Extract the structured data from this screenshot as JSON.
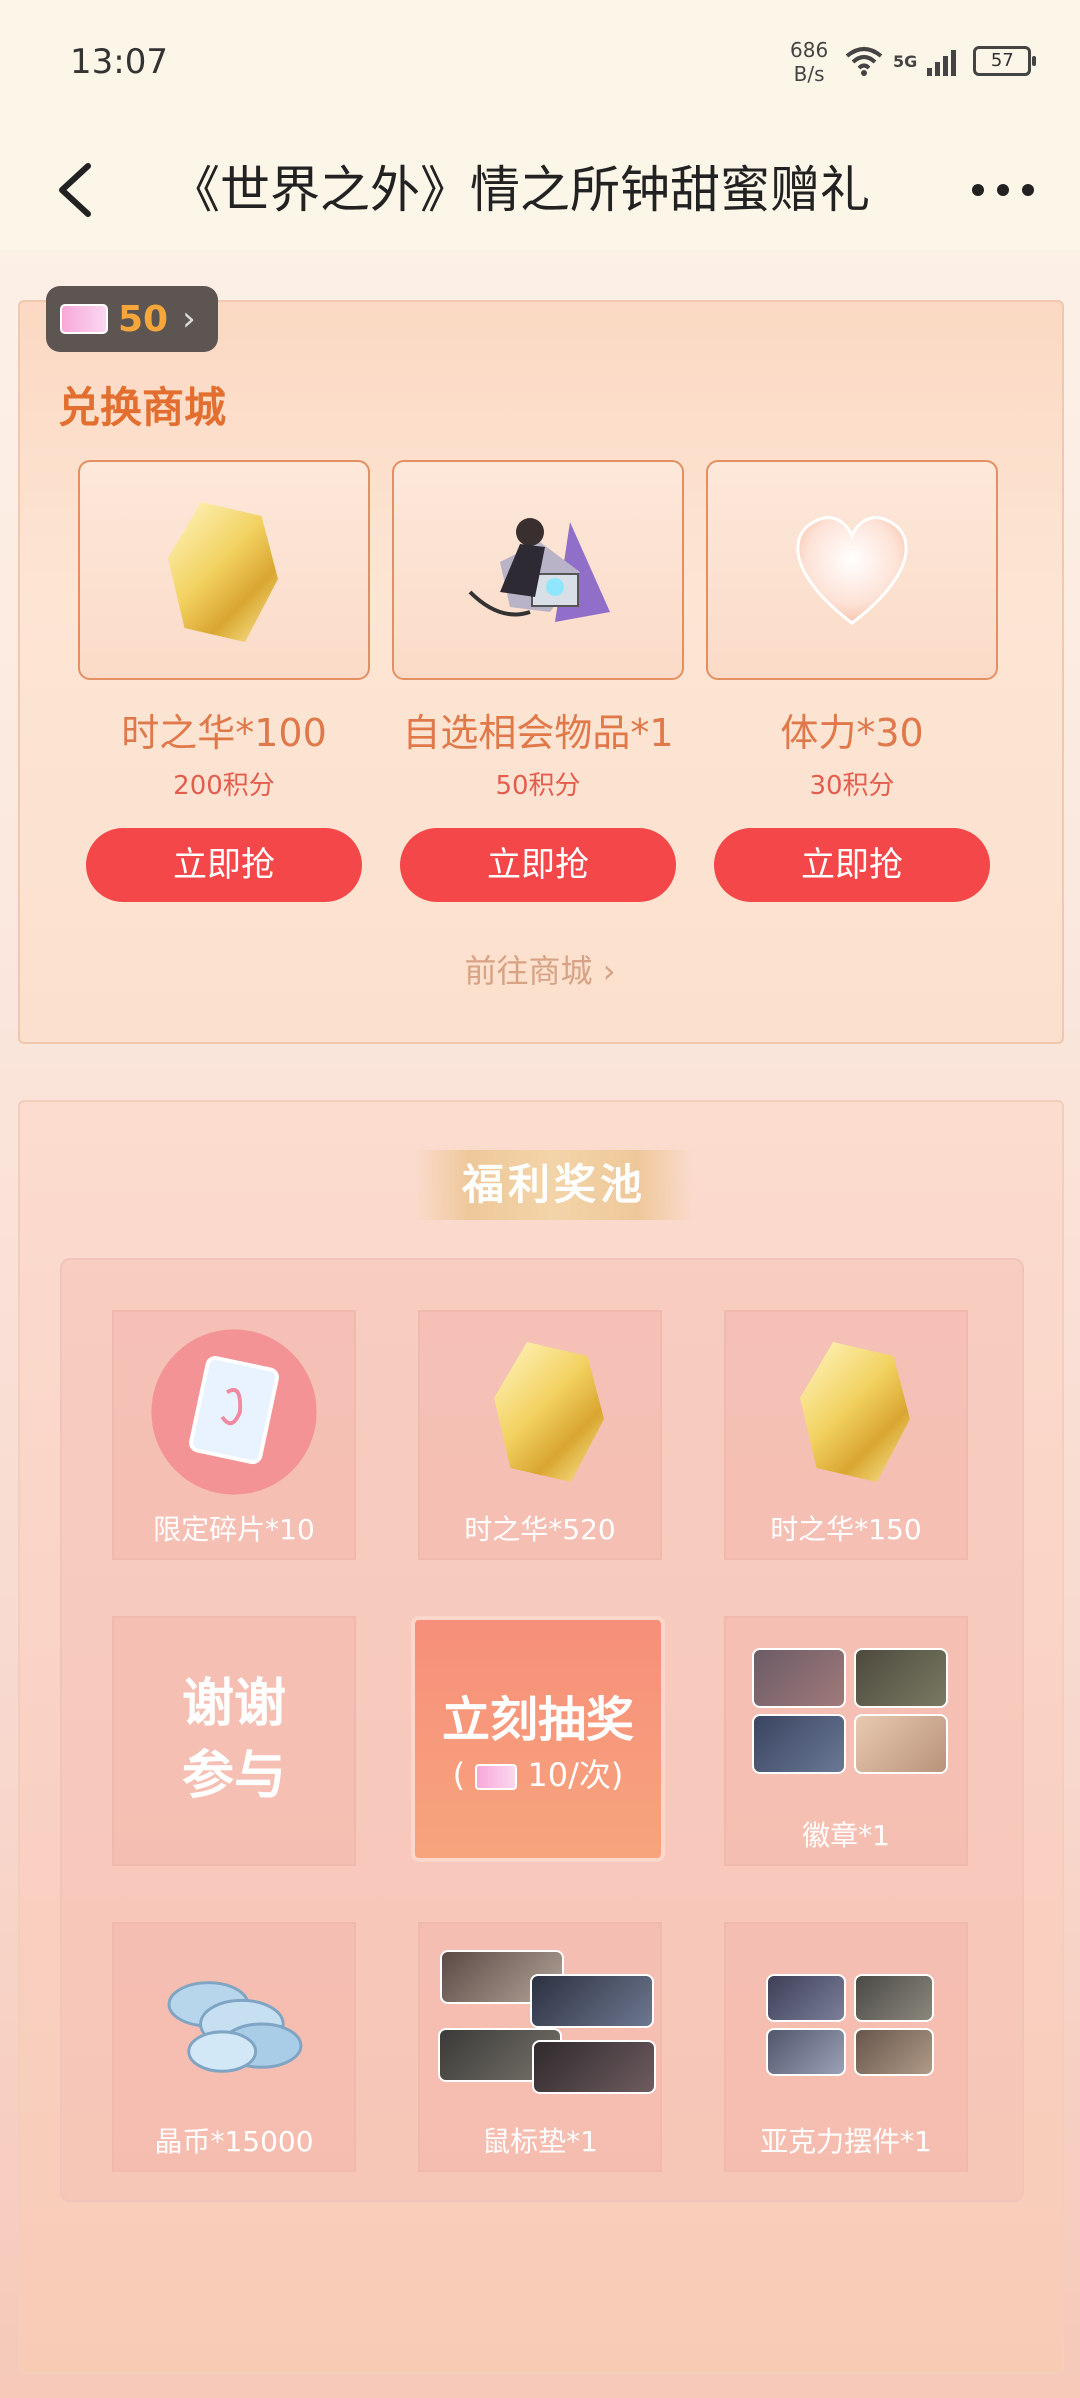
{
  "status_bar": {
    "time": "13:07",
    "net_speed_value": "686",
    "net_speed_unit": "B/s",
    "network": "5G",
    "battery": "57"
  },
  "header": {
    "title": "《世界之外》情之所钟甜蜜赠礼",
    "back_icon": "chevron-left-icon",
    "more_icon": "more-horizontal-icon"
  },
  "exchange": {
    "points": "50",
    "title": "兑换商城",
    "items": [
      {
        "name": "时之华*100",
        "price": "200积分",
        "button": "立即抢",
        "icon": "gold-crystal"
      },
      {
        "name": "自选相会物品*1",
        "price": "50积分",
        "button": "立即抢",
        "icon": "character-figure"
      },
      {
        "name": "体力*30",
        "price": "30积分",
        "button": "立即抢",
        "icon": "heart"
      }
    ],
    "goto_shop": "前往商城"
  },
  "pool": {
    "title": "福利奖池",
    "cells": [
      {
        "label": "限定碎片*10",
        "icon": "card-fragment"
      },
      {
        "label": "时之华*520",
        "icon": "gold-crystal"
      },
      {
        "label": "时之华*150",
        "icon": "gold-crystal"
      },
      {
        "label": "谢谢参与",
        "icon": "none"
      },
      {
        "label": "徽章*1",
        "icon": "badge-photos"
      },
      {
        "label": "晶币*15000",
        "icon": "coins"
      },
      {
        "label": "鼠标垫*1",
        "icon": "mousepad-photos"
      },
      {
        "label": "亚克力摆件*1",
        "icon": "acrylic-photos"
      }
    ],
    "thanks_line1": "谢谢",
    "thanks_line2": "参与",
    "draw_title": "立刻抽奖",
    "draw_cost_prefix": "(",
    "draw_cost": "10/次)"
  },
  "colors": {
    "accent_orange": "#e26f2f",
    "button_red": "#f4474a",
    "price_red": "#e35d4f"
  }
}
